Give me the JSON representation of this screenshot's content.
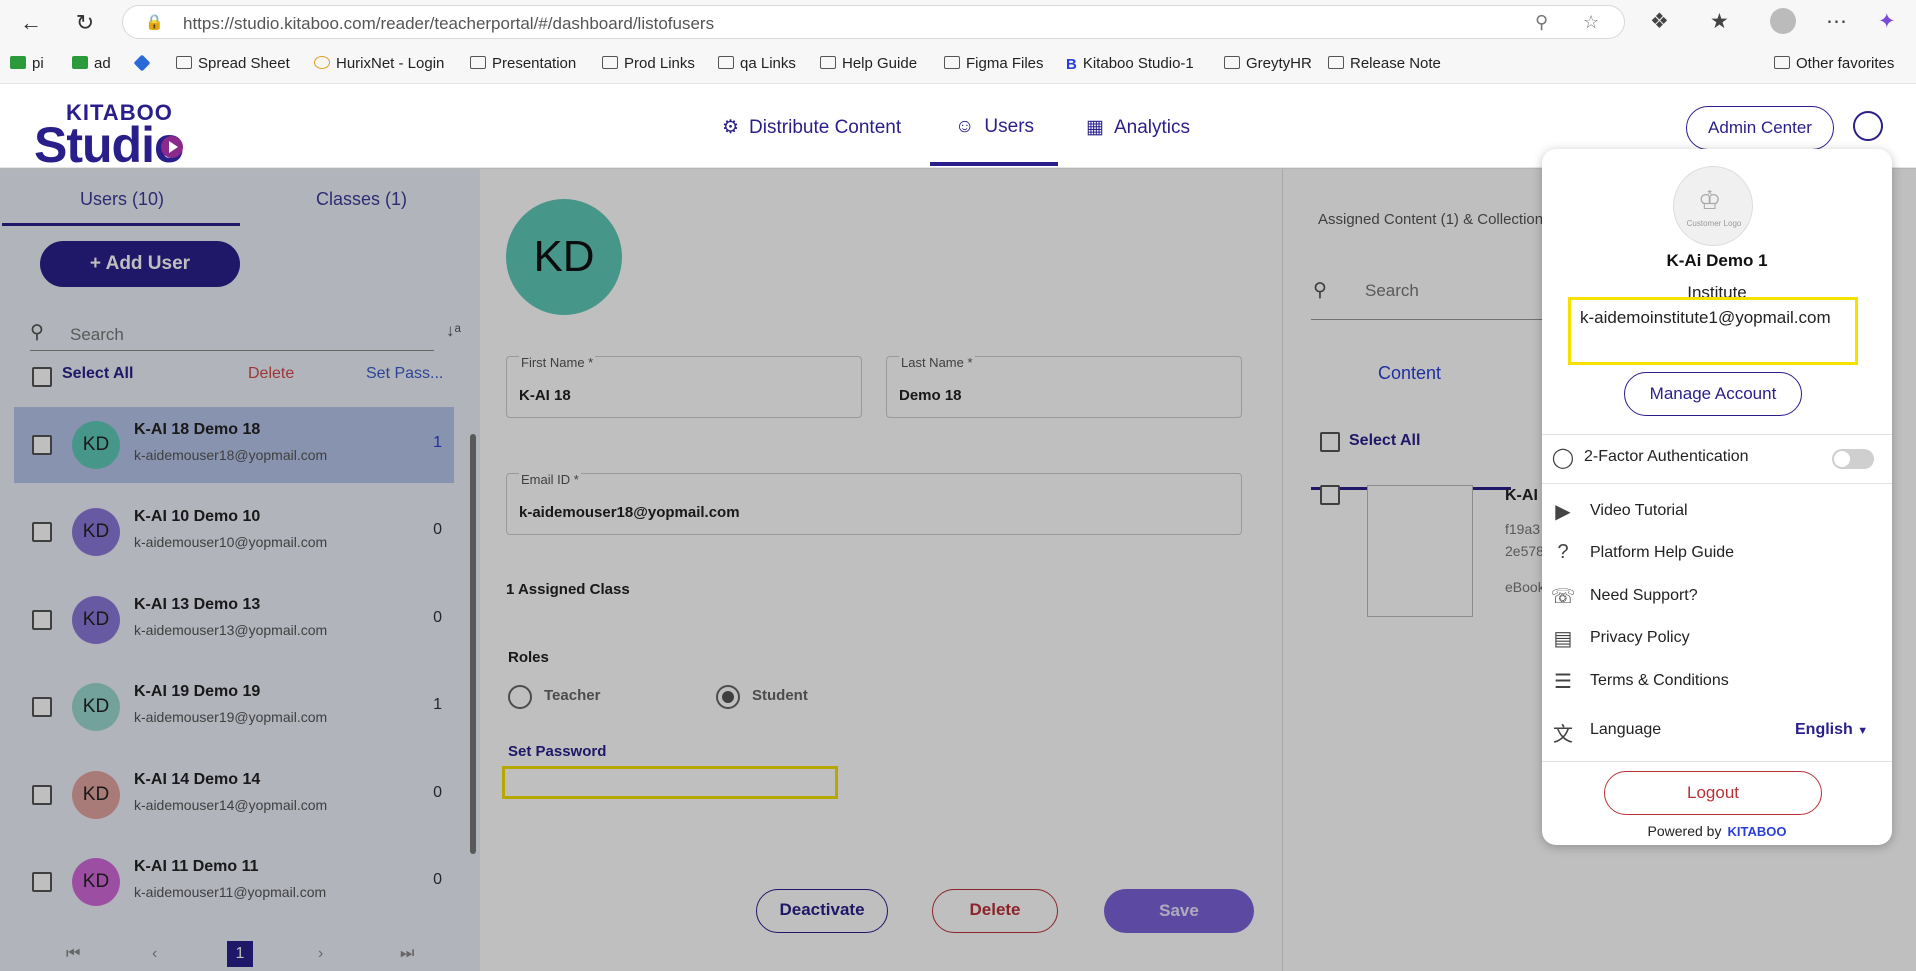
{
  "browser": {
    "url": "https://studio.kitaboo.com/reader/teacherportal/#/dashboard/listofusers",
    "bookmarks": [
      "pi",
      "ad",
      "Spread Sheet",
      "HurixNet - Login",
      "Presentation",
      "Prod Links",
      "qa Links",
      "Help Guide",
      "Figma Files",
      "Kitaboo Studio-1",
      "GreytyHR",
      "Release Note",
      "Other favorites"
    ]
  },
  "header": {
    "logo_top": "KITABOO",
    "logo_main": "Studio",
    "nav": [
      "Distribute Content",
      "Users",
      "Analytics"
    ],
    "admin_center": "Admin Center"
  },
  "left": {
    "tabs": [
      "Users (10)",
      "Classes (1)"
    ],
    "add_user": "+ Add User",
    "search_placeholder": "Search",
    "select_all": "Select All",
    "delete": "Delete",
    "set_password": "Set Pass...",
    "users": [
      {
        "initials": "KD",
        "name": "K-AI 18 Demo 18",
        "email": "k-aidemouser18@yopmail.com",
        "count": "1",
        "color": "#5ec9b7"
      },
      {
        "initials": "KD",
        "name": "K-AI 10 Demo 10",
        "email": "k-aidemouser10@yopmail.com",
        "count": "0",
        "color": "#8a79d8"
      },
      {
        "initials": "KD",
        "name": "K-AI 13 Demo 13",
        "email": "k-aidemouser13@yopmail.com",
        "count": "0",
        "color": "#8a79d8"
      },
      {
        "initials": "KD",
        "name": "K-AI 19 Demo 19",
        "email": "k-aidemouser19@yopmail.com",
        "count": "1",
        "color": "#9ad8d0"
      },
      {
        "initials": "KD",
        "name": "K-AI 14 Demo 14",
        "email": "k-aidemouser14@yopmail.com",
        "count": "0",
        "color": "#e0a4a0"
      },
      {
        "initials": "KD",
        "name": "K-AI 11 Demo 11",
        "email": "k-aidemouser11@yopmail.com",
        "count": "0",
        "color": "#d06ad8"
      }
    ],
    "pager_current": "1"
  },
  "detail": {
    "initials": "KD",
    "first_name_label": "First Name *",
    "first_name": "K-AI 18",
    "last_name_label": "Last Name *",
    "last_name": "Demo 18",
    "email_label": "Email ID *",
    "email": "k-aidemouser18@yopmail.com",
    "assigned_class": "1 Assigned Class",
    "roles_label": "Roles",
    "role_teacher": "Teacher",
    "role_student": "Student",
    "set_password": "Set Password",
    "deactivate": "Deactivate",
    "delete": "Delete",
    "save": "Save"
  },
  "right": {
    "assigned_title": "Assigned Content (1) & Collection",
    "search_placeholder": "Search",
    "tab_content": "Content",
    "select_all": "Select All",
    "book_title": "K-AI N",
    "book_id1": "f19a3",
    "book_id2": "2e578",
    "book_type": "eBook"
  },
  "dropdown": {
    "logo_caption": "Customer Logo",
    "name": "K-Ai Demo 1",
    "role": "Institute",
    "email": "k-aidemoinstitute1@yopmail.com",
    "manage_account": "Manage Account",
    "two_factor": "2-Factor Authentication",
    "items": [
      "Video Tutorial",
      "Platform Help Guide",
      "Need Support?",
      "Privacy Policy",
      "Terms & Conditions"
    ],
    "language_label": "Language",
    "language_value": "English",
    "logout": "Logout",
    "powered_by": "Powered by",
    "powered_brand": "KITABOO"
  }
}
